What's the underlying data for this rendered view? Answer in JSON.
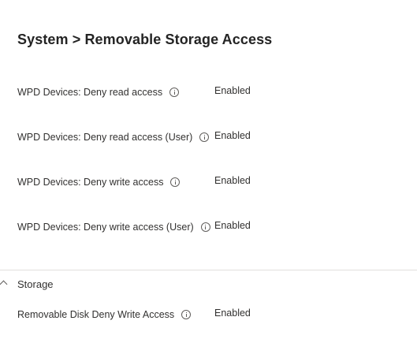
{
  "section": {
    "title": "System > Removable Storage Access"
  },
  "settings": [
    {
      "label": "WPD Devices: Deny read access",
      "value": "Enabled"
    },
    {
      "label": "WPD Devices: Deny read access (User)",
      "value": "Enabled"
    },
    {
      "label": "WPD Devices: Deny write access",
      "value": "Enabled"
    },
    {
      "label": "WPD Devices: Deny write access (User)",
      "value": "Enabled"
    }
  ],
  "group": {
    "label": "Storage",
    "icon": "chevron-up-icon",
    "settings": [
      {
        "label": "Removable Disk Deny Write Access",
        "value": "Enabled"
      }
    ]
  },
  "colors": {
    "text": "#323130",
    "title": "#242424",
    "divider": "#e1dfdd",
    "icon": "#605e5c"
  }
}
